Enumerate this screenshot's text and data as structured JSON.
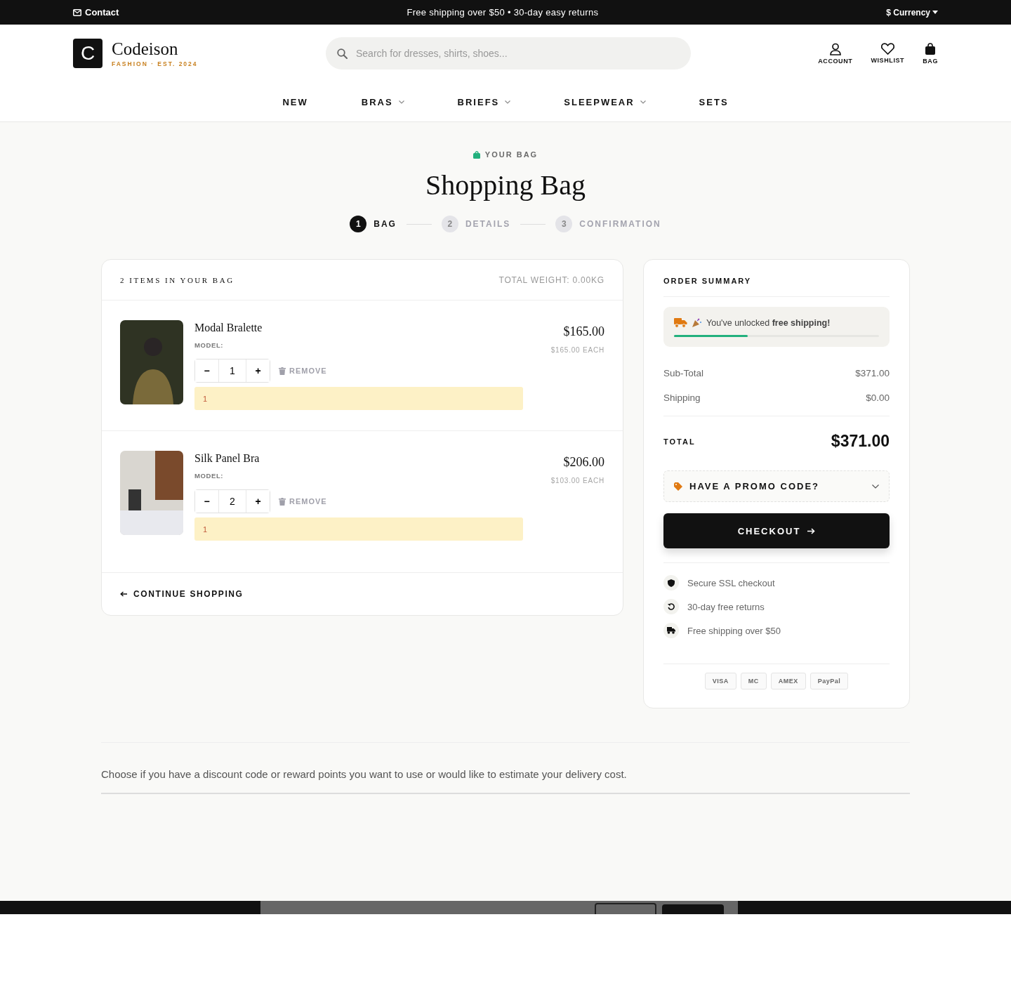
{
  "top_bar": {
    "contact": "Contact",
    "announcement": "Free shipping over $50 • 30-day easy returns",
    "currency": "$ Currency"
  },
  "header": {
    "logo_letter": "C",
    "brand": "Codeison",
    "tagline": "FASHION · EST. 2024",
    "search": {
      "placeholder": "Search for dresses, shirts, shoes..."
    },
    "actions": [
      {
        "kind": "account",
        "label": "ACCOUNT"
      },
      {
        "kind": "wishlist",
        "label": "WISHLIST"
      },
      {
        "kind": "bag",
        "label": "BAG"
      }
    ]
  },
  "nav": [
    {
      "label": "NEW",
      "has_menu": false
    },
    {
      "label": "BRAS",
      "has_menu": true
    },
    {
      "label": "BRIEFS",
      "has_menu": true
    },
    {
      "label": "SLEEPWEAR",
      "has_menu": true
    },
    {
      "label": "SETS",
      "has_menu": false
    }
  ],
  "eyebrow": "YOUR BAG",
  "title": "Shopping Bag",
  "steps": [
    {
      "number": "1",
      "label": "BAG",
      "selected": true
    },
    {
      "number": "2",
      "label": "DETAILS",
      "selected": false
    },
    {
      "number": "3",
      "label": "CONFIRMATION",
      "selected": false
    }
  ],
  "cart": {
    "count_label": "2 ITEMS IN YOUR BAG",
    "weight": "TOTAL WEIGHT: 0.00KG",
    "items": [
      {
        "name": "Modal Bralette",
        "model_label": "MODEL:",
        "decrease": "−",
        "quantity": "1",
        "increase": "+",
        "remove": "REMOVE",
        "notice": "1",
        "price": "$165.00",
        "each": "$165.00 EACH"
      },
      {
        "name": "Silk Panel Bra",
        "model_label": "MODEL:",
        "decrease": "−",
        "quantity": "2",
        "increase": "+",
        "remove": "REMOVE",
        "notice": "1",
        "price": "$206.00",
        "each": "$103.00 EACH"
      }
    ],
    "continue": "CONTINUE SHOPPING"
  },
  "summary": {
    "title": "ORDER SUMMARY",
    "shipping_banner": {
      "text": "You've unlocked **free shipping!**",
      "level": 0.36
    },
    "lines": [
      {
        "label": "Sub-Total",
        "value": "$371.00"
      },
      {
        "label": "Shipping",
        "value": "$0.00"
      }
    ],
    "total_label": "TOTAL",
    "total": "$371.00",
    "promo": {
      "label": "HAVE A PROMO CODE?",
      "expanded": false
    },
    "checkout": "CHECKOUT",
    "perks": [
      {
        "kind": "shield",
        "label": "Secure SSL checkout"
      },
      {
        "kind": "returns",
        "label": "30-day free returns"
      },
      {
        "kind": "truck",
        "label": "Free shipping over $50"
      }
    ],
    "payments": [
      "VISA",
      "MC",
      "AMEX",
      "PayPal"
    ]
  },
  "note": "Choose if you have a discount code or reward points you want to use or would like to estimate your delivery cost."
}
